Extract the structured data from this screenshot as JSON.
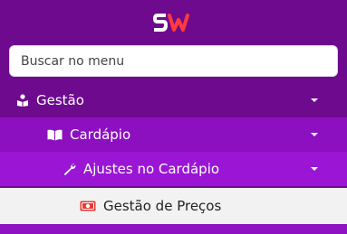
{
  "brand": {
    "logo_text": "SW",
    "logo_color_s": "#ffffff",
    "logo_color_w": "#ff3b3b"
  },
  "search": {
    "placeholder": "Buscar no menu",
    "value": ""
  },
  "menu": {
    "gestao": {
      "label": "Gestão",
      "icon": "person-book-icon"
    },
    "cardapio": {
      "label": "Cardápio",
      "icon": "open-book-icon"
    },
    "ajustes": {
      "label": "Ajustes no Cardápio",
      "icon": "wrench-icon"
    },
    "precos": {
      "label": "Gestão de Preços",
      "icon": "money-bill-icon"
    }
  },
  "colors": {
    "sidebar_bg": "#6d0a8e",
    "level2_bg": "#8c10c0",
    "level3_bg": "#9a16d4",
    "active_bg": "#f2f2f2",
    "money_icon": "#e53935"
  }
}
